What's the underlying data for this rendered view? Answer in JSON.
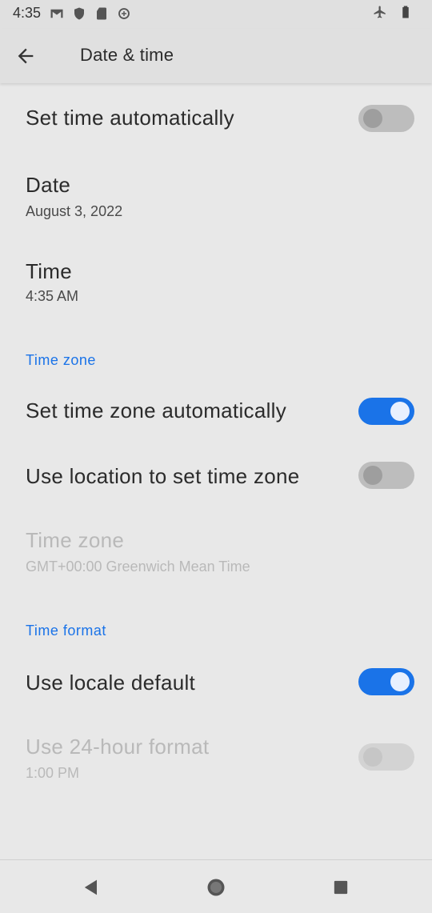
{
  "status_bar": {
    "time": "4:35",
    "left_icons": [
      "gmail-icon",
      "shield-icon",
      "sd-card-icon",
      "data-saver-icon"
    ],
    "right_icons": [
      "airplane-mode-icon",
      "battery-icon"
    ]
  },
  "app_bar": {
    "title": "Date & time"
  },
  "settings": {
    "set_time_automatically": {
      "title": "Set time automatically",
      "enabled": false
    },
    "date": {
      "title": "Date",
      "value": "August 3, 2022"
    },
    "time": {
      "title": "Time",
      "value": "4:35 AM"
    },
    "time_zone_header": "Time zone",
    "set_time_zone_automatically": {
      "title": "Set time zone automatically",
      "enabled": true
    },
    "use_location": {
      "title": "Use location to set time zone",
      "enabled": false
    },
    "time_zone": {
      "title": "Time zone",
      "value": "GMT+00:00 Greenwich Mean Time"
    },
    "time_format_header": "Time format",
    "use_locale_default": {
      "title": "Use locale default",
      "enabled": true
    },
    "use_24_hour": {
      "title": "Use 24-hour format",
      "value": "1:00 PM",
      "enabled": false
    }
  },
  "colors": {
    "accent": "#1a73e8",
    "background": "#e8e8e8"
  },
  "nav_bar": {
    "icons": [
      "back-triangle-icon",
      "home-circle-icon",
      "recents-square-icon"
    ]
  }
}
